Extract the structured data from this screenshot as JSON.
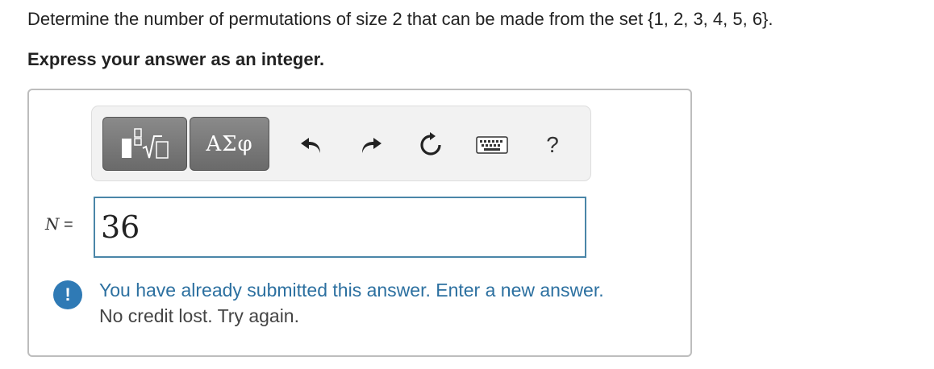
{
  "question": {
    "text": "Determine the number of permutations of size 2 that can be made from the set {1, 2, 3, 4, 5, 6}.",
    "instruction": "Express your answer as an integer."
  },
  "toolbar": {
    "symbols_label": "ΑΣφ",
    "help_label": "?",
    "icons": [
      "templates-icon",
      "undo-icon",
      "redo-icon",
      "reset-icon",
      "keyboard-icon",
      "help-icon"
    ]
  },
  "answer": {
    "variable": "N",
    "equals": " =",
    "value": "36"
  },
  "feedback": {
    "icon": "!",
    "message": "You have already submitted this answer. Enter a new answer.",
    "detail": "No credit lost. Try again."
  },
  "colors": {
    "accent": "#2f7ab5",
    "feedback_text": "#2c70a0",
    "input_border": "#4a86a8",
    "toolbar_button": "#777777"
  }
}
